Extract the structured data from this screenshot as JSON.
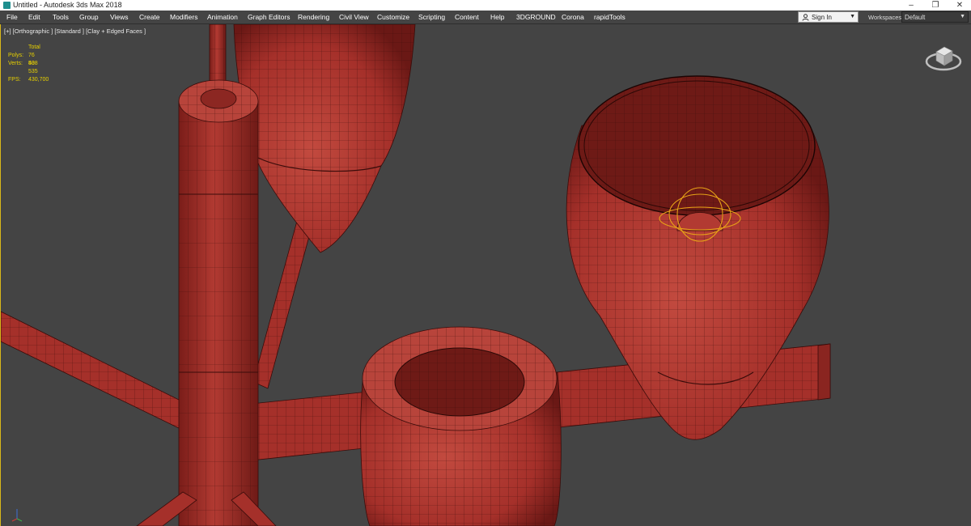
{
  "window": {
    "title": "Untitled - Autodesk 3ds Max 2018",
    "controls": {
      "minimize": "–",
      "restore": "❐",
      "close": "✕"
    }
  },
  "menu": {
    "items": [
      "File",
      "Edit",
      "Tools",
      "Group",
      "Views",
      "Create",
      "Modifiers",
      "Animation",
      "Graph Editors",
      "Rendering",
      "Civil View",
      "Customize",
      "Scripting",
      "Content",
      "Help",
      "3DGROUND",
      "Corona",
      "rapidTools"
    ]
  },
  "account": {
    "sign_in_label": "Sign In",
    "icon": "user-icon"
  },
  "workspaces": {
    "label": "Workspaces:",
    "value": "Default"
  },
  "viewport": {
    "label": "[+] [Orthographic ] [Standard ] [Clay + Edged Faces ]",
    "stats": {
      "total_label": "Total",
      "polys_label": "Polys:",
      "polys_value": "76 538",
      "verts_label": "Verts:",
      "verts_value": "40 535",
      "fps_label": "FPS:",
      "fps_value": "430,700"
    },
    "colors": {
      "background": "#444444",
      "clay": "#a5302a",
      "wire": "#3a0c0a",
      "stats_text": "#e7d000",
      "light_gizmo": "#e8a317"
    }
  }
}
